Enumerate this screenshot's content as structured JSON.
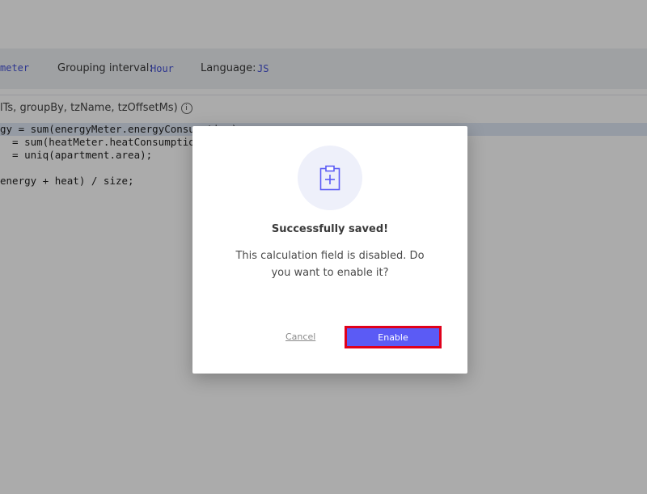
{
  "toolbar": {
    "meter_value": "meter",
    "grouping_label": "Grouping interval:",
    "grouping_value": "Hour",
    "language_label": "Language:",
    "language_value": "JS"
  },
  "signature": {
    "text": "lTs, groupBy, tzName, tzOffsetMs)"
  },
  "code": {
    "lines": [
      "gy = sum(energyMeter.energyConsumption);",
      "  = sum(heatMeter.heatConsumption);",
      "  = uniq(apartment.area);",
      "",
      "energy + heat) / size;"
    ]
  },
  "modal": {
    "icon": "clipboard-plus-icon",
    "title": "Successfully saved!",
    "message": "This calculation field is disabled. Do you want to enable it?",
    "cancel_label": "Cancel",
    "enable_label": "Enable"
  },
  "colors": {
    "accent": "#5b5bf5",
    "highlight_border": "#e0001b",
    "overlay": "rgba(0,0,0,0.33)"
  }
}
